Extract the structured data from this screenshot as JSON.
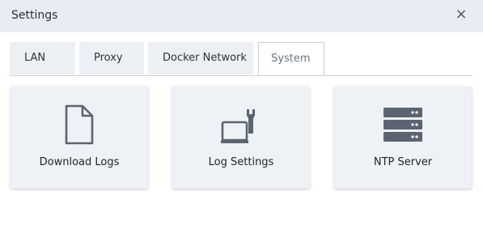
{
  "dialog": {
    "title": "Settings",
    "close_label": "×"
  },
  "tabs": [
    {
      "label": "LAN"
    },
    {
      "label": "Proxy"
    },
    {
      "label": "Docker Network"
    },
    {
      "label": "System",
      "active": true
    }
  ],
  "cards": [
    {
      "label": "Download Logs",
      "icon": "document-icon"
    },
    {
      "label": "Log Settings",
      "icon": "laptop-wrench-icon"
    },
    {
      "label": "NTP Server",
      "icon": "server-stack-icon"
    }
  ],
  "colors": {
    "header_bg": "#e9edf3",
    "card_bg": "#eef1f6",
    "icon": "#5b6470",
    "tab_bg": "#eceff4"
  }
}
